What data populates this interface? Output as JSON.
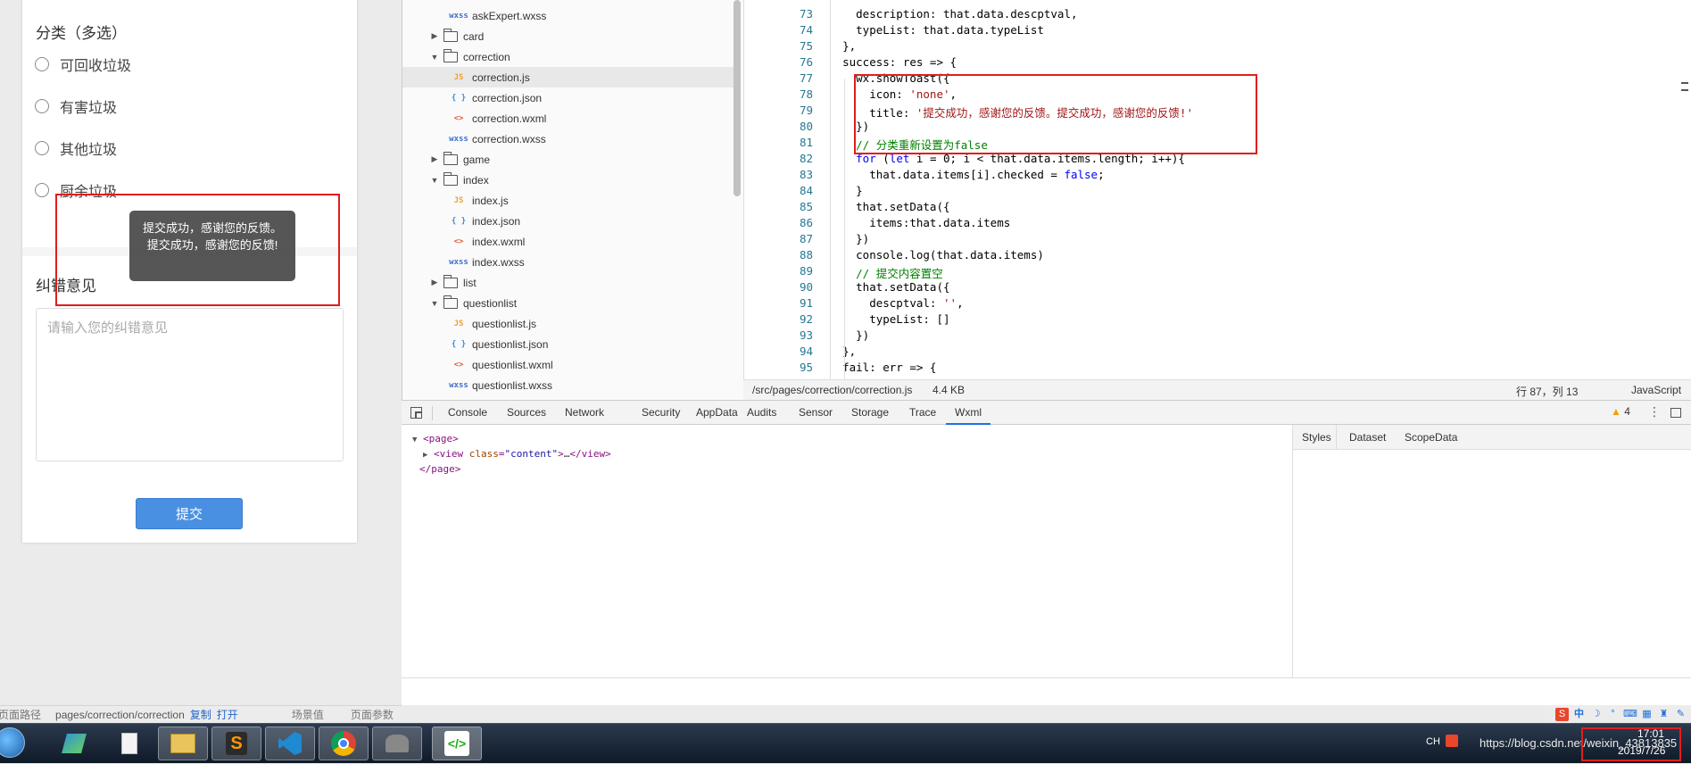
{
  "simulator": {
    "category_title": "分类（多选）",
    "options": [
      "可回收垃圾",
      "有害垃圾",
      "其他垃圾",
      "厨余垃圾"
    ],
    "toast": "提交成功，感谢您的反馈。提交成功，感谢您的反馈!",
    "feedback_title": "纠错意见",
    "textarea_placeholder": "请输入您的纠错意见",
    "submit_label": "提交",
    "status": {
      "path_label": "页面路径",
      "path": "pages/correction/correction",
      "copy": "复制",
      "open": "打开",
      "scene": "场景值",
      "params": "页面参数"
    }
  },
  "tree": {
    "items": [
      {
        "name": "askExpert.wxss",
        "type": "wxss",
        "indent": 2
      },
      {
        "name": "card",
        "type": "folder",
        "indent": 1,
        "open": false
      },
      {
        "name": "correction",
        "type": "folder",
        "indent": 1,
        "open": true
      },
      {
        "name": "correction.js",
        "type": "js",
        "indent": 2,
        "selected": true
      },
      {
        "name": "correction.json",
        "type": "json",
        "indent": 2
      },
      {
        "name": "correction.wxml",
        "type": "wxml",
        "indent": 2
      },
      {
        "name": "correction.wxss",
        "type": "wxss",
        "indent": 2
      },
      {
        "name": "game",
        "type": "folder",
        "indent": 1,
        "open": false
      },
      {
        "name": "index",
        "type": "folder",
        "indent": 1,
        "open": true
      },
      {
        "name": "index.js",
        "type": "js",
        "indent": 2
      },
      {
        "name": "index.json",
        "type": "json",
        "indent": 2
      },
      {
        "name": "index.wxml",
        "type": "wxml",
        "indent": 2
      },
      {
        "name": "index.wxss",
        "type": "wxss",
        "indent": 2
      },
      {
        "name": "list",
        "type": "folder",
        "indent": 1,
        "open": false
      },
      {
        "name": "questionlist",
        "type": "folder",
        "indent": 1,
        "open": true
      },
      {
        "name": "questionlist.js",
        "type": "js",
        "indent": 2
      },
      {
        "name": "questionlist.json",
        "type": "json",
        "indent": 2
      },
      {
        "name": "questionlist.wxml",
        "type": "wxml",
        "indent": 2
      },
      {
        "name": "questionlist.wxss",
        "type": "wxss",
        "indent": 2
      }
    ],
    "icons": {
      "js": "JS",
      "json": "{ }",
      "wxml": "<>",
      "wxss": "wxss"
    }
  },
  "editor": {
    "lines": [
      {
        "n": "73",
        "t": "      description: that.data.descptval,"
      },
      {
        "n": "74",
        "t": "      typeList: that.data.typeList"
      },
      {
        "n": "75",
        "t": "    },"
      },
      {
        "n": "76",
        "t": "    success: res => {"
      },
      {
        "n": "77",
        "t": "      wx.showToast({"
      },
      {
        "n": "78",
        "t": "        icon: 'none',"
      },
      {
        "n": "79",
        "t": "        title: '提交成功，感谢您的反馈。提交成功，感谢您的反馈!'"
      },
      {
        "n": "80",
        "t": "      })"
      },
      {
        "n": "81",
        "t": "      // 分类重新设置为false"
      },
      {
        "n": "82",
        "t": "      for (let i = 0; i < that.data.items.length; i++){"
      },
      {
        "n": "83",
        "t": "        that.data.items[i].checked = false;"
      },
      {
        "n": "84",
        "t": "      }"
      },
      {
        "n": "85",
        "t": "      that.setData({"
      },
      {
        "n": "86",
        "t": "        items:that.data.items"
      },
      {
        "n": "87",
        "t": "      })"
      },
      {
        "n": "88",
        "t": "      console.log(that.data.items)"
      },
      {
        "n": "89",
        "t": "      // 提交内容置空"
      },
      {
        "n": "90",
        "t": "      that.setData({"
      },
      {
        "n": "91",
        "t": "        descptval: '',"
      },
      {
        "n": "92",
        "t": "        typeList: []"
      },
      {
        "n": "93",
        "t": "      })"
      },
      {
        "n": "94",
        "t": "    },"
      },
      {
        "n": "95",
        "t": "    fail: err => {"
      }
    ],
    "status": {
      "file_path": "/src/pages/correction/correction.js",
      "file_size": "4.4 KB",
      "cursor": "行 87，列 13",
      "language": "JavaScript"
    }
  },
  "devtools": {
    "tabs": [
      "Console",
      "Sources",
      "Network",
      "Security",
      "AppData",
      "Audits",
      "Sensor",
      "Storage",
      "Trace",
      "Wxml"
    ],
    "active_tab": "Wxml",
    "warning_count": "4",
    "wxml_tree": [
      "<page>",
      "<view class=\"content\">…</view>",
      "</page>"
    ],
    "style_tabs": [
      "Styles",
      "Dataset",
      "ScopeData"
    ]
  },
  "taskbar": {
    "lang": "CH",
    "watermark": "https://blog.csdn.net/weixin_43813835",
    "time": "17:01",
    "date": "2019/7/26"
  }
}
